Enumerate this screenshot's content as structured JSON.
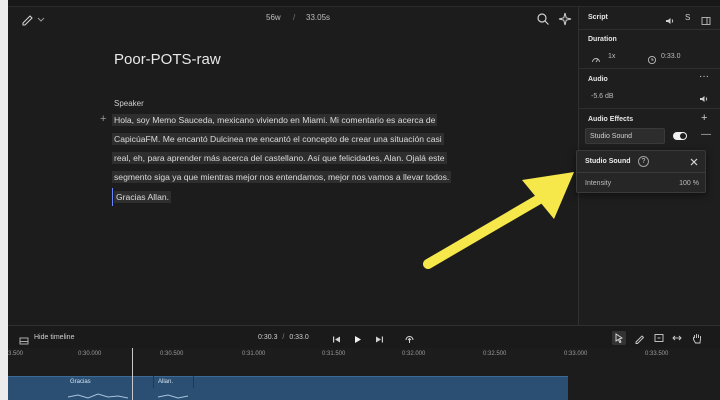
{
  "editor": {
    "word_count": "56w",
    "separator": "/",
    "duration": "33.05s",
    "title": "Poor-POTS-raw",
    "speaker": "Speaker",
    "add_symbol": "+",
    "lines": [
      "Hola, soy Memo Sauceda,  mexicano viviendo en Miami. Mi comentario es acerca de",
      "CapicúaFM. Me encantó Dulcinea me encantó el concepto de crear una situación casi",
      "real, eh, para aprender más acerca del castellano. Así que felicidades, Alan. Ojalá este",
      "segmento siga ya que mientras mejor nos entendamos, mejor nos vamos a llevar todos."
    ],
    "paragraph2": "Gracias Allan."
  },
  "panel": {
    "script_label": "Script",
    "script_symbol": "S",
    "duration_title": "Duration",
    "speed": "1x",
    "duration_value": "0:33.0",
    "audio_title": "Audio",
    "gain": "-5.6 dB",
    "effects_title": "Audio Effects",
    "effect_name": "Studio Sound",
    "effect_enabled": true
  },
  "popup": {
    "title": "Studio Sound",
    "help": "?",
    "intensity_label": "Intensity",
    "intensity_value": "100 %"
  },
  "timeline": {
    "hide_label": "Hide timeline",
    "current_time": "0:30.3",
    "time_sep": "/",
    "total_time": "0:33.0",
    "ticks": [
      "3.500",
      "0:30.000",
      "0:30.500",
      "0:31.000",
      "0:31.500",
      "0:32.000",
      "0:32.500",
      "0:33.000",
      "0:33.500"
    ],
    "segments": [
      "Gracias",
      "Allan."
    ]
  },
  "colors": {
    "highlight": "#ffe94a",
    "track": "#2a4f73",
    "cursor": "#6a86ff"
  }
}
